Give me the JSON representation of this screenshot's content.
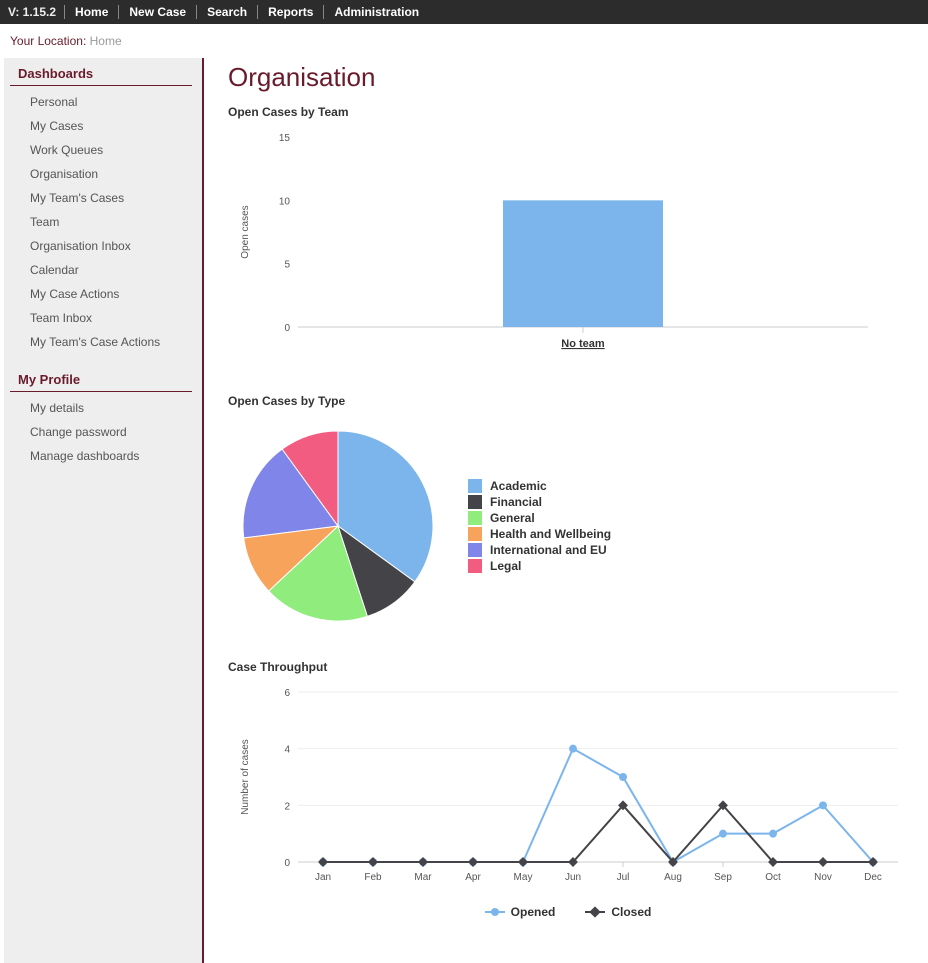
{
  "topbar": {
    "version": "V: 1.15.2",
    "links": [
      "Home",
      "New Case",
      "Search",
      "Reports",
      "Administration"
    ]
  },
  "breadcrumb": {
    "label": "Your Location:",
    "location": "Home"
  },
  "sidebar": {
    "sections": [
      {
        "title": "Dashboards",
        "items": [
          "Personal",
          "My Cases",
          "Work Queues",
          "Organisation",
          "My Team's Cases",
          "Team",
          "Organisation Inbox",
          "Calendar",
          "My Case Actions",
          "Team Inbox",
          "My Team's Case Actions"
        ]
      },
      {
        "title": "My Profile",
        "items": [
          "My details",
          "Change password",
          "Manage dashboards"
        ]
      }
    ]
  },
  "page": {
    "title": "Organisation"
  },
  "chart_data": [
    {
      "type": "bar",
      "title": "Open Cases by Team",
      "ylabel": "Open cases",
      "categories": [
        "No team"
      ],
      "values": [
        10
      ],
      "ylim": [
        0,
        15
      ],
      "yticks": [
        0,
        5,
        10,
        15
      ],
      "colors": {
        "bar": "#7cb5ec"
      },
      "xlink_underline": true
    },
    {
      "type": "pie",
      "title": "Open Cases by Type",
      "series": [
        {
          "name": "Academic",
          "value": 35,
          "color": "#7cb5ec"
        },
        {
          "name": "Financial",
          "value": 10,
          "color": "#434348"
        },
        {
          "name": "General",
          "value": 18,
          "color": "#90ed7d"
        },
        {
          "name": "Health and Wellbeing",
          "value": 10,
          "color": "#f7a35c"
        },
        {
          "name": "International and EU",
          "value": 17,
          "color": "#8085e9"
        },
        {
          "name": "Legal",
          "value": 10,
          "color": "#f15c80"
        }
      ]
    },
    {
      "type": "line",
      "title": "Case Throughput",
      "ylabel": "Number of cases",
      "x": [
        "Jan",
        "Feb",
        "Mar",
        "Apr",
        "May",
        "Jun",
        "Jul",
        "Aug",
        "Sep",
        "Oct",
        "Nov",
        "Dec"
      ],
      "series": [
        {
          "name": "Opened",
          "color": "#7cb5ec",
          "values": [
            0,
            0,
            0,
            0,
            0,
            4,
            3,
            0,
            1,
            1,
            2,
            0
          ]
        },
        {
          "name": "Closed",
          "color": "#434348",
          "values": [
            0,
            0,
            0,
            0,
            0,
            0,
            2,
            0,
            2,
            0,
            0,
            0
          ]
        }
      ],
      "ylim": [
        0,
        6
      ],
      "yticks": [
        0,
        2,
        4,
        6
      ]
    }
  ]
}
